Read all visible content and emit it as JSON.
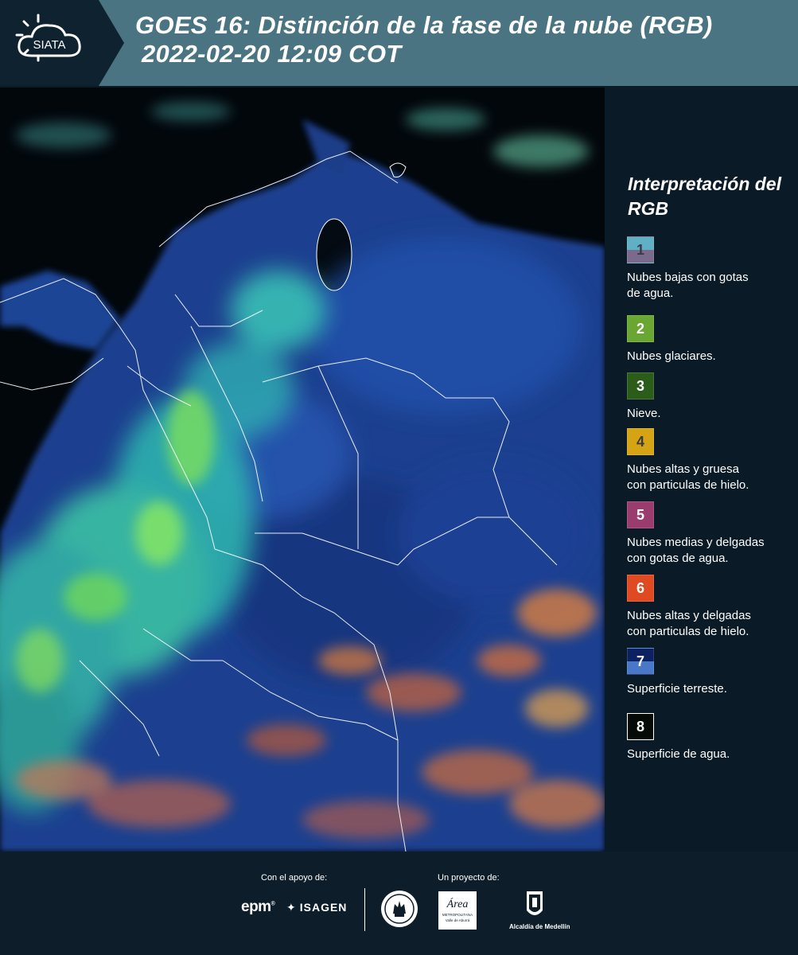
{
  "header": {
    "logo_text": "SIATA",
    "title_line1": "GOES 16: Distinción de la fase de la nube (RGB)",
    "title_line2": "2022-02-20 12:09 COT",
    "background": "#4b7482"
  },
  "map": {
    "description_icon": "satellite-map",
    "boundary_color": "#ffffff",
    "ocean_color": "#02070c",
    "land_color": "#1b3f8f"
  },
  "legend": {
    "title": "Interpretación del RGB",
    "items": [
      {
        "number": "1",
        "label": "Nubes bajas con gotas\nde agua.",
        "color_top": "#5fb0c4",
        "color_bottom": "#7a6a8c",
        "number_color": "#3a3a4a"
      },
      {
        "number": "2",
        "label": "Nubes glaciares.",
        "color_top": "#6aa632",
        "color_bottom": "#6aa632",
        "number_color": "#ffffff"
      },
      {
        "number": "3",
        "label": "Nieve.",
        "color_top": "#2b5c1a",
        "color_bottom": "#2b5c1a",
        "number_color": "#ffffff"
      },
      {
        "number": "4",
        "label": "Nubes altas y gruesa\ncon particulas de hielo.",
        "color_top": "#d4a414",
        "color_bottom": "#d4a414",
        "number_color": "#3a3a3a"
      },
      {
        "number": "5",
        "label": "Nubes medias y delgadas\ncon gotas de agua.",
        "color_top": "#9a3c6e",
        "color_bottom": "#9a3c6e",
        "number_color": "#ffffff"
      },
      {
        "number": "6",
        "label": "Nubes altas y delgadas\ncon particulas de hielo.",
        "color_top": "#e04a22",
        "color_bottom": "#e04a22",
        "number_color": "#ffffff"
      },
      {
        "number": "7",
        "label": "Superficie terreste.",
        "color_top": "#0d2060",
        "color_bottom": "#4a78c8",
        "number_color": "#ffffff"
      },
      {
        "number": "8",
        "label": "Superficie de agua.",
        "color_top": "#050a06",
        "color_bottom": "#050a06",
        "number_color": "#ffffff"
      }
    ]
  },
  "footer": {
    "support_label": "Con el apoyo de:",
    "project_label": "Un proyecto de:",
    "epm_text": "epm",
    "isagen_text": "ISAGEN",
    "amva_text": "Área",
    "amva_sub1": "METROPOLITANA",
    "amva_sub2": "Valle de Aburrá",
    "alcaldia_text": "Alcaldía de Medellín"
  }
}
